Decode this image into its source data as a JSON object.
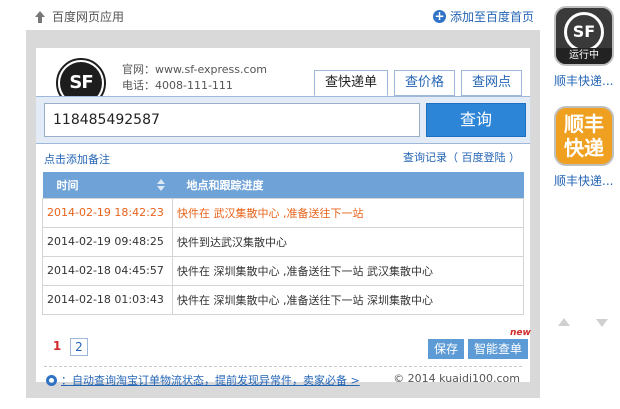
{
  "topbar": {
    "breadcrumb": "百度网页应用",
    "add_home": "添加至百度首页"
  },
  "company": {
    "logo_text": "SF",
    "website": "官网：www.sf-express.com",
    "phone": "电话：4008-111-111"
  },
  "tabs": [
    {
      "label": "查快递单",
      "active": true
    },
    {
      "label": "查价格",
      "active": false
    },
    {
      "label": "查网点",
      "active": false
    }
  ],
  "search": {
    "value": "118485492587",
    "button": "查询"
  },
  "links": {
    "add_note": "点击添加备注",
    "history": "查询记录",
    "login": "（ 百度登陆 ）"
  },
  "table": {
    "headers": {
      "time": "时间",
      "progress": "地点和跟踪进度"
    },
    "rows": [
      {
        "time": "2014-02-19 18:42:23",
        "progress": "快件在 武汉集散中心 ,准备送往下一站"
      },
      {
        "time": "2014-02-19 09:48:25",
        "progress": "快件到达武汉集散中心"
      },
      {
        "time": "2014-02-18 04:45:57",
        "progress": "快件在 深圳集散中心 ,准备送往下一站 武汉集散中心"
      },
      {
        "time": "2014-02-18 01:03:43",
        "progress": "快件在 深圳集散中心 ,准备送往下一站 深圳集散中心"
      }
    ]
  },
  "pager": {
    "current": "1",
    "next": "2"
  },
  "actions": {
    "save": "保存",
    "smart": "智能查单",
    "new_badge": "new"
  },
  "footer": {
    "promo": "：自动查询淘宝订单物流状态，提前发现异常件，卖家必备 >",
    "copyright": "© 2014 kuaidi100.com"
  },
  "sidebar": {
    "app1": {
      "icon_text": "SF",
      "strip": "运行中",
      "label": "顺丰快递..."
    },
    "app2": {
      "icon_text": "顺丰快递",
      "label": "顺丰快递..."
    }
  },
  "colors": {
    "accent": "#2d85d8",
    "header": "#6fa3d8",
    "highlight": "#e8631a"
  }
}
